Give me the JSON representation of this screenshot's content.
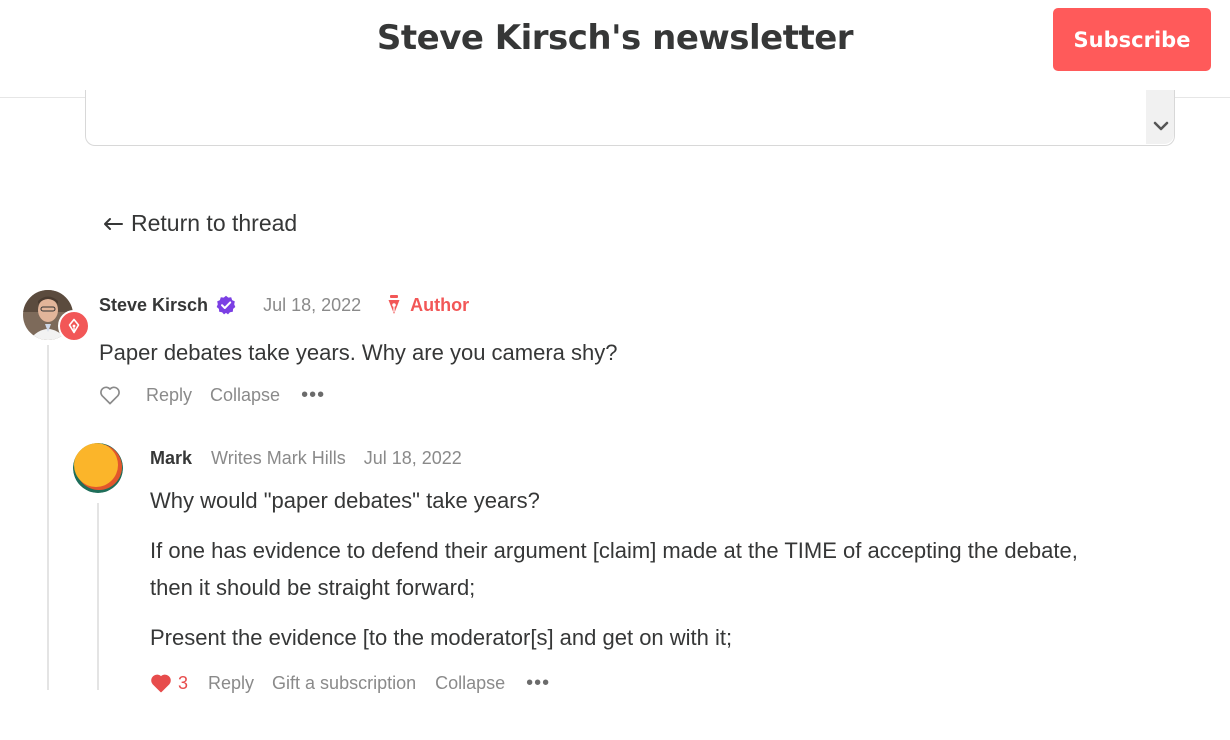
{
  "header": {
    "title": "Steve Kirsch's newsletter",
    "subscribe_label": "Subscribe"
  },
  "navigation": {
    "return_label": "Return to thread"
  },
  "comments": [
    {
      "author": "Steve Kirsch",
      "verified": true,
      "date": "Jul 18, 2022",
      "tag": "Author",
      "paragraphs": [
        "Paper debates take years. Why are you camera shy?"
      ],
      "actions": {
        "reply": "Reply",
        "collapse": "Collapse",
        "more": "•••"
      }
    },
    {
      "author": "Mark",
      "byline": "Writes Mark Hills",
      "date": "Jul 18, 2022",
      "paragraphs": [
        "Why would \"paper debates\" take years?",
        "If one has evidence to defend their argument [claim] made at the TIME of accepting the debate,",
        "then it should be straight forward;",
        "Present the evidence [to the moderator[s] and get on with it;"
      ],
      "like_count": "3",
      "actions": {
        "reply": "Reply",
        "gift": "Gift a subscription",
        "collapse": "Collapse",
        "more": "•••"
      }
    }
  ],
  "colors": {
    "accent": "#ff5a5a",
    "verified": "#7b3fe4",
    "author_tag": "#f25757",
    "muted_text": "#8a8a8a"
  },
  "icons": [
    "chevron-down-icon",
    "arrow-left-icon",
    "verified-check-icon",
    "pen-nib-icon",
    "heart-outline-icon",
    "heart-filled-icon"
  ]
}
